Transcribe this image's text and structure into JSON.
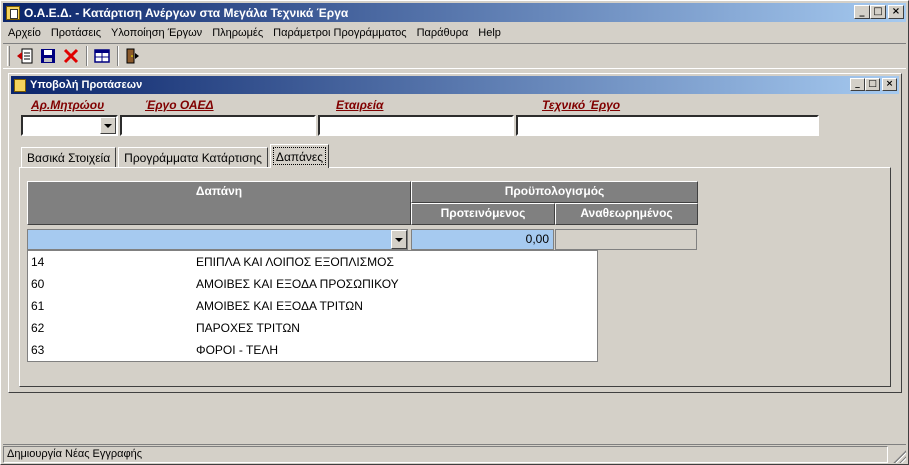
{
  "app": {
    "title": "Ο.Α.Ε.Δ. - Κατάρτιση Ανέργων στα Μεγάλα Τεχνικά Έργα"
  },
  "window_buttons": {
    "minimize": "_",
    "maximize": "□",
    "close": "×"
  },
  "menu": [
    "Αρχείο",
    "Προτάσεις",
    "Υλοποίηση Έργων",
    "Πληρωμές",
    "Παράμετροι Προγράμματος",
    "Παράθυρα",
    "Help"
  ],
  "toolbar": {
    "icons": [
      "new-record-icon",
      "save-icon",
      "delete-icon",
      "grid-icon",
      "exit-icon"
    ]
  },
  "child": {
    "title": "Υποβολή Προτάσεων"
  },
  "fields": {
    "ar_mitroou": {
      "label": "Αρ.Μητρώου",
      "value": ""
    },
    "ergo_oaed": {
      "label": "Έργο ΟΑΕΔ",
      "value": ""
    },
    "etaireia": {
      "label": "Εταιρεία",
      "value": ""
    },
    "texniko_ergo": {
      "label": "Τεχνικό Έργο",
      "value": ""
    }
  },
  "tabs": [
    {
      "label": "Βασικά Στοιχεία",
      "active": false
    },
    {
      "label": "Προγράμματα Κατάρτισης",
      "active": false
    },
    {
      "label": "Δαπάνες",
      "active": true
    }
  ],
  "grid": {
    "col_dapani": "Δαπάνη",
    "col_proypologismos": "Προϋπολογισμός",
    "col_proteinomenos": "Προτεινόμενος",
    "col_anatheorimenos": "Αναθεωρημένος",
    "current_row": {
      "dapani": "",
      "proteinomenos": "0,00",
      "anatheorimenos": ""
    }
  },
  "dropdown": [
    {
      "code": "14",
      "desc": "ΕΠΙΠΛΑ ΚΑΙ ΛΟΙΠΟΣ ΕΞΟΠΛΙΣΜΟΣ"
    },
    {
      "code": "60",
      "desc": "ΑΜΟΙΒΕΣ ΚΑΙ ΕΞΟΔΑ ΠΡΟΣΩΠΙΚΟΥ"
    },
    {
      "code": "61",
      "desc": "ΑΜΟΙΒΕΣ ΚΑΙ ΕΞΟΔΑ ΤΡΙΤΩΝ"
    },
    {
      "code": "62",
      "desc": "ΠΑΡΟΧΕΣ ΤΡΙΤΩΝ"
    },
    {
      "code": "63",
      "desc": "ΦΟΡΟΙ - ΤΕΛΗ"
    }
  ],
  "status": {
    "text": "Δημιουργία Νέας Εγγραφής"
  },
  "colors": {
    "titlebar_start": "#0a246a",
    "titlebar_end": "#a6caf0",
    "label_color": "#800000",
    "selection": "#a6caf0",
    "header_bg": "#808080"
  }
}
